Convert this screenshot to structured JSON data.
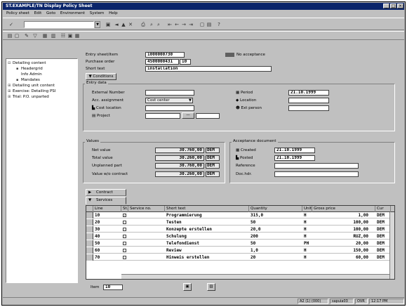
{
  "window": {
    "title": "ST.EXAMPLE/TN Display Policy Sheet"
  },
  "menu": [
    "Policy sheet",
    "Edit",
    "Goto",
    "Environment",
    "System",
    "Help"
  ],
  "tree": {
    "items": [
      {
        "label": "Detailing content",
        "level": 0
      },
      {
        "label": "Headergrid",
        "level": 1
      },
      {
        "label": "Info Admin",
        "level": 1,
        "selected": true
      },
      {
        "label": "Mandates",
        "level": 1
      },
      {
        "label": "Detailing unit content",
        "level": 0
      },
      {
        "label": "Exercise: Detailing PSI",
        "level": 0
      },
      {
        "label": "Trial: P.O. unparted",
        "level": 0
      }
    ]
  },
  "header": {
    "entry_sheet_label": "Entry sheet/item",
    "entry_sheet_value": "1000000730",
    "accepted_label": "Ok",
    "accepted_text": "No acceptance",
    "purchase_order_label": "Purchase order",
    "purchase_order_value": "4500000431",
    "purchase_order_item": "10",
    "short_text_label": "Short text",
    "short_text_value": "installation",
    "conditions_button": "Conditions"
  },
  "origin": {
    "title": "Entry data",
    "ext_number_label": "External Number",
    "ext_number_value": "",
    "acct_assign_label": "Acc. assignment",
    "acct_assign_value": "Cost center",
    "cost_center_label": "Cost location",
    "cost_center_value": "",
    "project_label": "Project",
    "project_value": "",
    "period_label": "Period",
    "period_value": "21.10.1999",
    "location_label": "Location",
    "location_value": "",
    "ext_person_label": "Ext person",
    "ext_person_value": ""
  },
  "values": {
    "title": "Values",
    "rows": [
      {
        "label": "Net value",
        "value": "30.760,00",
        "unit": "DEM"
      },
      {
        "label": "Total value",
        "value": "30.260,00",
        "unit": "DEM"
      },
      {
        "label": "Unplanned part",
        "value": "30.760,00",
        "unit": "DEM"
      },
      {
        "label": "Value w/o contract",
        "value": "30.260,00",
        "unit": "DEM"
      }
    ]
  },
  "acceptance": {
    "title": "Acceptance document",
    "created_label": "Created",
    "created_value": "21.10.1999",
    "posted_label": "Posted",
    "posted_value": "21.10.1999",
    "reference_label": "Reference",
    "reference_value": "",
    "doc_header_label": "Doc.hdr.",
    "doc_header_value": ""
  },
  "tabs": {
    "contract": "Contract",
    "services": "Services"
  },
  "table": {
    "columns": [
      "Line",
      "St.",
      "Service no.",
      "Short text",
      "Quantity",
      "Unit",
      "Gross price",
      "Cur"
    ],
    "rows": [
      {
        "line": "10",
        "checked": true,
        "service": "",
        "text": "Programmierung",
        "qty": "315,0",
        "unit": "H",
        "price": "1,00",
        "cur": "DEM"
      },
      {
        "line": "20",
        "checked": false,
        "service": "",
        "text": "Testen",
        "qty": "50",
        "unit": "H",
        "price": "100,00",
        "cur": "DEM"
      },
      {
        "line": "30",
        "checked": false,
        "service": "",
        "text": "Konzepte erstellen",
        "qty": "20,0",
        "unit": "H",
        "price": "100,00",
        "cur": "DEM"
      },
      {
        "line": "40",
        "checked": false,
        "service": "",
        "text": "Schulung",
        "qty": "200",
        "unit": "H",
        "price": "RUZ,00",
        "cur": "DEM"
      },
      {
        "line": "50",
        "checked": false,
        "service": "",
        "text": "Telefondienst",
        "qty": "50",
        "unit": "PH",
        "price": "20,00",
        "cur": "DEM"
      },
      {
        "line": "60",
        "checked": false,
        "service": "",
        "text": "Review",
        "qty": "1,0",
        "unit": "H",
        "price": "150,00",
        "cur": "DEM"
      },
      {
        "line": "70",
        "checked": false,
        "service": "",
        "text": "Hinweis erstellen",
        "qty": "20",
        "unit": "H",
        "price": "60,00",
        "cur": "DEM"
      }
    ]
  },
  "footer": {
    "item_label": "Item",
    "item_value": "10"
  },
  "status": {
    "seg1": "A2 (1) (000)",
    "seg2": "sapuia03",
    "seg3": "OVR",
    "seg4": "12:17 PM"
  }
}
